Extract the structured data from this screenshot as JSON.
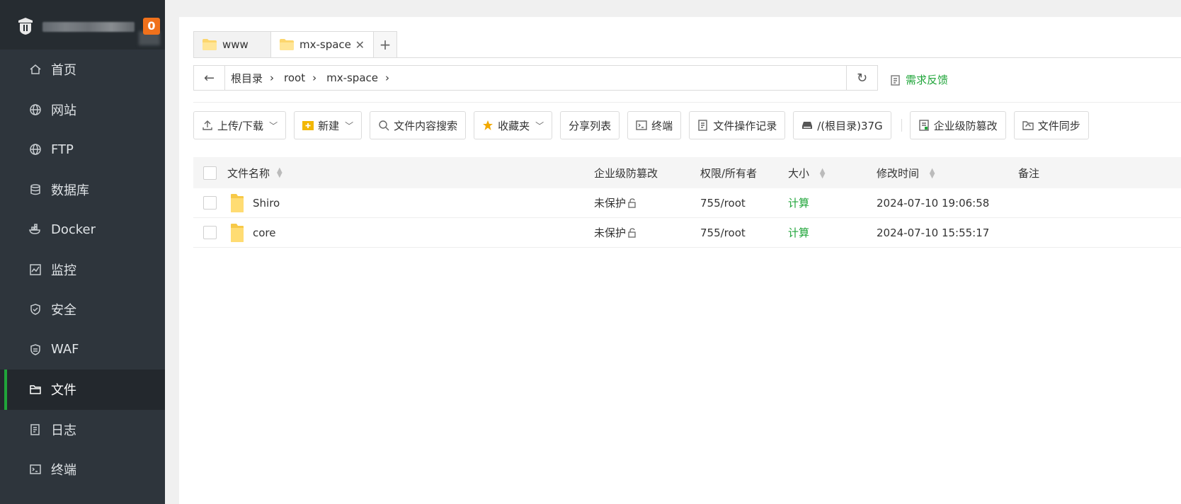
{
  "sidebar": {
    "badge": "0",
    "items": [
      {
        "label": "首页",
        "icon": "home-icon"
      },
      {
        "label": "网站",
        "icon": "globe-icon"
      },
      {
        "label": "FTP",
        "icon": "globe-icon"
      },
      {
        "label": "数据库",
        "icon": "database-icon"
      },
      {
        "label": "Docker",
        "icon": "docker-icon"
      },
      {
        "label": "监控",
        "icon": "monitor-icon"
      },
      {
        "label": "安全",
        "icon": "shield-icon"
      },
      {
        "label": "WAF",
        "icon": "waf-icon"
      },
      {
        "label": "文件",
        "icon": "folder-icon",
        "active": true
      },
      {
        "label": "日志",
        "icon": "log-icon"
      },
      {
        "label": "终端",
        "icon": "terminal-icon"
      }
    ]
  },
  "tabs": [
    {
      "label": "www"
    },
    {
      "label": "mx-space",
      "active": true
    }
  ],
  "address": {
    "crumbs": [
      "根目录",
      "root",
      "mx-space"
    ],
    "feedback": "需求反馈"
  },
  "toolbar": {
    "upload": "上传/下载",
    "new": "新建",
    "search": "文件内容搜索",
    "favorites": "收藏夹",
    "share": "分享列表",
    "terminal": "终端",
    "oplog": "文件操作记录",
    "disk": "/(根目录)37G",
    "tamper": "企业级防篡改",
    "sync": "文件同步"
  },
  "table": {
    "headers": {
      "name": "文件名称",
      "protect": "企业级防篡改",
      "perm": "权限/所有者",
      "size": "大小",
      "time": "修改时间",
      "note": "备注"
    },
    "rows": [
      {
        "name": "Shiro",
        "protect": "未保护",
        "perm": "755/root",
        "size": "计算",
        "time": "2024-07-10 19:06:58"
      },
      {
        "name": "core",
        "protect": "未保护",
        "perm": "755/root",
        "size": "计算",
        "time": "2024-07-10 15:55:17"
      }
    ]
  },
  "colors": {
    "accent": "#20a53a",
    "badge": "#f0711b",
    "sidebar": "#2e353c"
  }
}
